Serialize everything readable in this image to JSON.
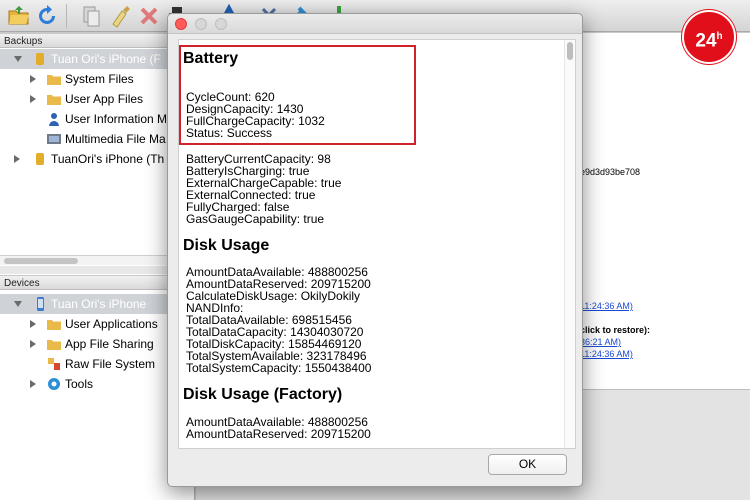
{
  "toolbar": {
    "icons": [
      "folder-open-icon",
      "refresh-icon",
      "copy-icon",
      "clean-icon",
      "delete-icon",
      "backup-icon",
      "history-icon",
      "tools-icon",
      "pin-icon",
      "install-icon"
    ]
  },
  "sidebar": {
    "backups_header": "Backups",
    "backups": [
      {
        "label": "Tuan Ori's iPhone (F",
        "selected": true,
        "expanded": true,
        "level": 0,
        "icon": "cylinder-icon"
      },
      {
        "label": "System Files",
        "level": 1,
        "icon": "folder-icon"
      },
      {
        "label": "User App Files",
        "level": 1,
        "icon": "folder-icon"
      },
      {
        "label": "User Information M",
        "level": 1,
        "icon": "person-icon"
      },
      {
        "label": "Multimedia File Ma",
        "level": 1,
        "icon": "multimedia-icon"
      },
      {
        "label": "TuanOri's iPhone (Th",
        "level": 0,
        "icon": "cylinder-icon"
      }
    ],
    "devices_header": "Devices",
    "devices": [
      {
        "label": "Tuan Ori's iPhone",
        "selected": true,
        "expanded": true,
        "level": 0,
        "icon": "phone-icon"
      },
      {
        "label": "User Applications",
        "level": 1,
        "icon": "folder-icon"
      },
      {
        "label": "App File Sharing",
        "level": 1,
        "icon": "folder-icon"
      },
      {
        "label": "Raw File System",
        "level": 1,
        "icon": "raw-files-icon"
      },
      {
        "label": "Tools",
        "level": 1,
        "icon": "gear-icon"
      }
    ]
  },
  "detail_peek": {
    "hash": "e9d3d93be708",
    "link1": "11:24:36 AM)",
    "restore_hint": "click to restore):",
    "link2": "36:21 AM)",
    "link3": "11:24:36 AM)"
  },
  "watermark": {
    "text": "24",
    "sup": "h"
  },
  "dialog": {
    "battery_title": "Battery",
    "battery_highlighted": [
      {
        "key": "CycleCount",
        "value": "620"
      },
      {
        "key": "DesignCapacity",
        "value": "1430"
      },
      {
        "key": "FullChargeCapacity",
        "value": "1032"
      },
      {
        "key": "Status",
        "value": "Success"
      }
    ],
    "battery_more": [
      {
        "key": "BatteryCurrentCapacity",
        "value": "98"
      },
      {
        "key": "BatteryIsCharging",
        "value": "true"
      },
      {
        "key": "ExternalChargeCapable",
        "value": "true"
      },
      {
        "key": "ExternalConnected",
        "value": "true"
      },
      {
        "key": "FullyCharged",
        "value": "false"
      },
      {
        "key": "GasGaugeCapability",
        "value": "true"
      }
    ],
    "disk_title": "Disk Usage",
    "disk": [
      {
        "key": "AmountDataAvailable",
        "value": "488800256"
      },
      {
        "key": "AmountDataReserved",
        "value": "209715200"
      },
      {
        "key": "CalculateDiskUsage",
        "value": "OkilyDokily"
      },
      {
        "key": "NANDInfo",
        "value": ""
      },
      {
        "key": "TotalDataAvailable",
        "value": "698515456"
      },
      {
        "key": "TotalDataCapacity",
        "value": "14304030720"
      },
      {
        "key": "TotalDiskCapacity",
        "value": "15854469120"
      },
      {
        "key": "TotalSystemAvailable",
        "value": "323178496"
      },
      {
        "key": "TotalSystemCapacity",
        "value": "1550438400"
      }
    ],
    "factory_title": "Disk Usage (Factory)",
    "factory": [
      {
        "key": "AmountDataAvailable",
        "value": "488800256"
      },
      {
        "key": "AmountDataReserved",
        "value": "209715200"
      }
    ],
    "ok_label": "OK",
    "highlight_color": "#d1212a"
  }
}
